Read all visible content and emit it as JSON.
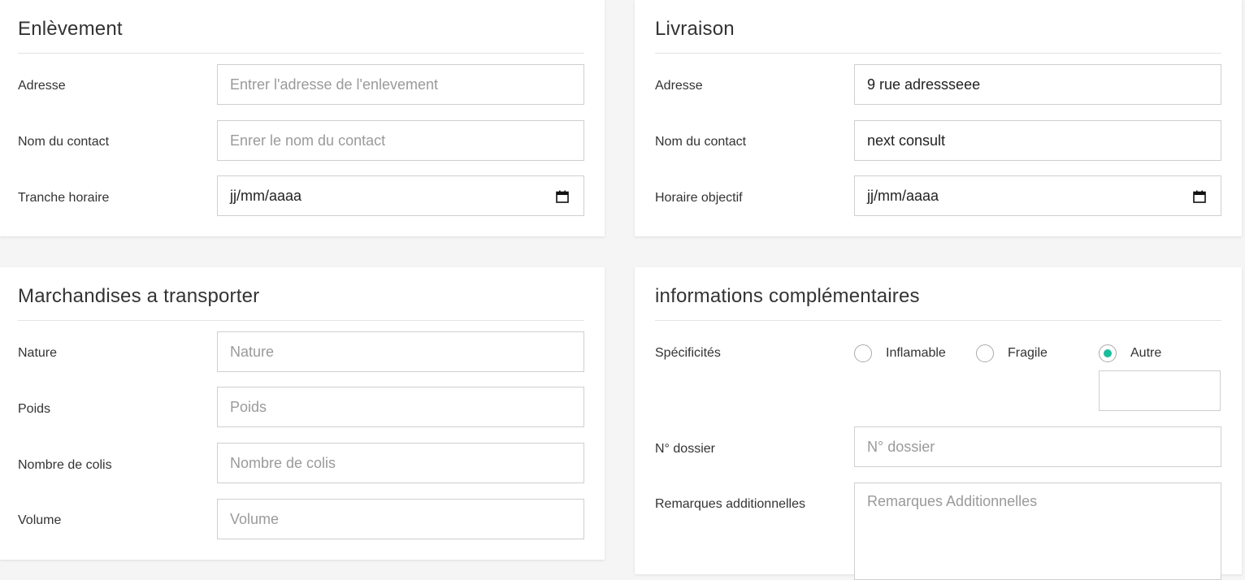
{
  "pickup": {
    "title": "Enlèvement",
    "address_label": "Adresse",
    "address_placeholder": "Entrer l'adresse de l'enlevement",
    "contact_label": "Nom du contact",
    "contact_placeholder": "Enrer le nom du contact",
    "timeslot_label": "Tranche horaire",
    "date_placeholder": "jj/mm/aaaa"
  },
  "delivery": {
    "title": "Livraison",
    "address_label": "Adresse",
    "address_value": "9 rue adressseee",
    "contact_label": "Nom du contact",
    "contact_value": "next consult",
    "target_time_label": "Horaire objectif",
    "date_placeholder": "jj/mm/aaaa"
  },
  "goods": {
    "title": "Marchandises a transporter",
    "nature_label": "Nature",
    "nature_placeholder": "Nature",
    "weight_label": "Poids",
    "weight_placeholder": "Poids",
    "packages_label": "Nombre de colis",
    "packages_placeholder": "Nombre de colis",
    "volume_label": "Volume",
    "volume_placeholder": "Volume"
  },
  "extra": {
    "title": "informations complémentaires",
    "specifics_label": "Spécificités",
    "options": [
      {
        "label": "Inflamable",
        "checked": false
      },
      {
        "label": "Fragile",
        "checked": false
      },
      {
        "label": "Autre",
        "checked": true
      }
    ],
    "other_value": "",
    "file_label": "N° dossier",
    "file_placeholder": "N° dossier",
    "remarks_label": "Remarques additionnelles",
    "remarks_placeholder": "Remarques Additionnelles"
  },
  "colors": {
    "page_bg": "#f5f5f5",
    "card_bg": "#ffffff",
    "accent": "#1bbc9b",
    "border": "#cfcfcf"
  }
}
